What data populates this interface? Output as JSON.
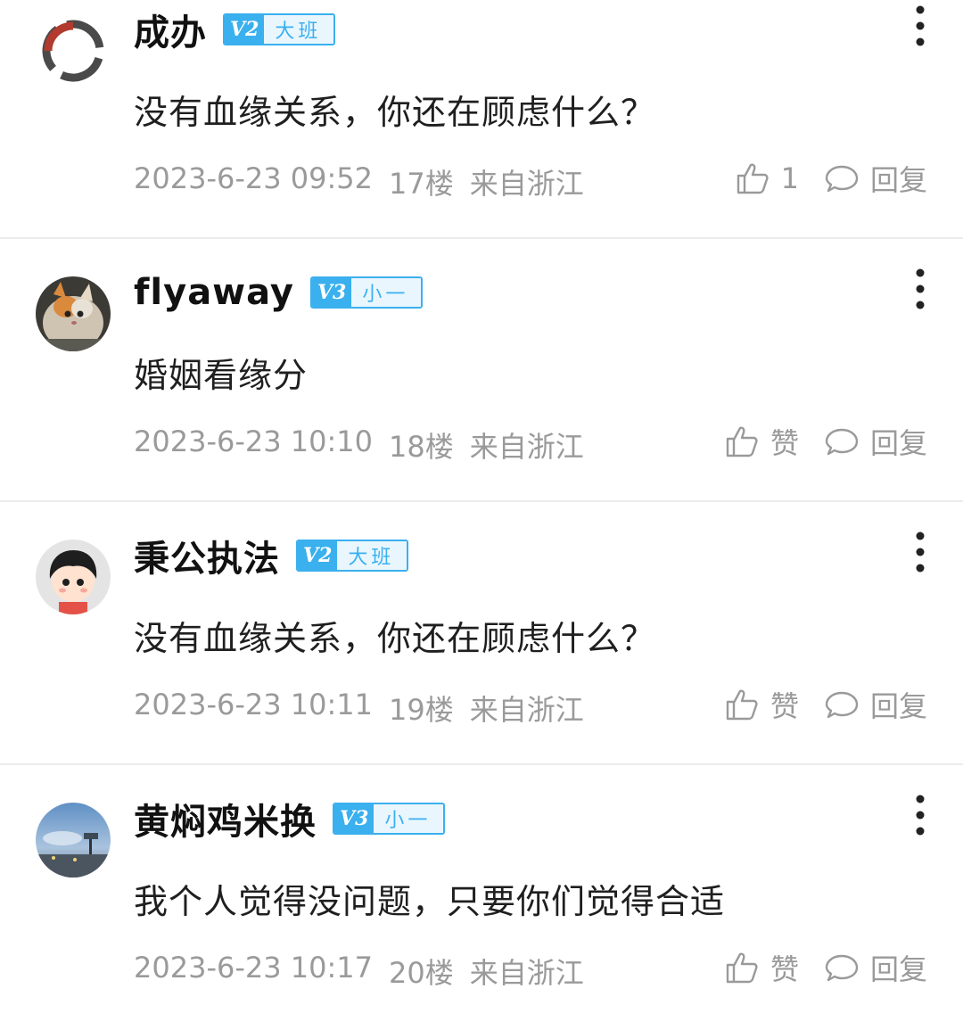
{
  "comments": [
    {
      "username": "成办",
      "badge": {
        "level": "V2",
        "title": "大班"
      },
      "avatar": "ring-logo-avatar",
      "content": "没有血缘关系，你还在顾虑什么？",
      "date": "2023-6-23 09:52",
      "floor": "17楼",
      "location": "来自浙江",
      "like_label": "1",
      "reply_label": "回复"
    },
    {
      "username": "flyaway",
      "badge": {
        "level": "V3",
        "title": "小一"
      },
      "avatar": "kitten-avatar",
      "content": "婚姻看缘分",
      "date": "2023-6-23 10:10",
      "floor": "18楼",
      "location": "来自浙江",
      "like_label": "赞",
      "reply_label": "回复"
    },
    {
      "username": "秉公执法",
      "badge": {
        "level": "V2",
        "title": "大班"
      },
      "avatar": "cartoon-boy-avatar",
      "content": "没有血缘关系，你还在顾虑什么？",
      "date": "2023-6-23 10:11",
      "floor": "19楼",
      "location": "来自浙江",
      "like_label": "赞",
      "reply_label": "回复"
    },
    {
      "username": "黄焖鸡米换",
      "badge": {
        "level": "V3",
        "title": "小一"
      },
      "avatar": "sky-landscape-avatar",
      "content": "我个人觉得没问题，只要你们觉得合适",
      "date": "2023-6-23 10:17",
      "floor": "20楼",
      "location": "来自浙江",
      "like_label": "赞",
      "reply_label": "回复"
    }
  ],
  "colors": {
    "badge_accent": "#3ab0ee",
    "badge_bg": "#eaf6fe",
    "meta_text": "#9a9a9a",
    "divider": "#ececec"
  },
  "icons": {
    "more": "more-vertical-icon",
    "like": "thumbs-up-icon",
    "reply": "speech-bubble-icon"
  }
}
